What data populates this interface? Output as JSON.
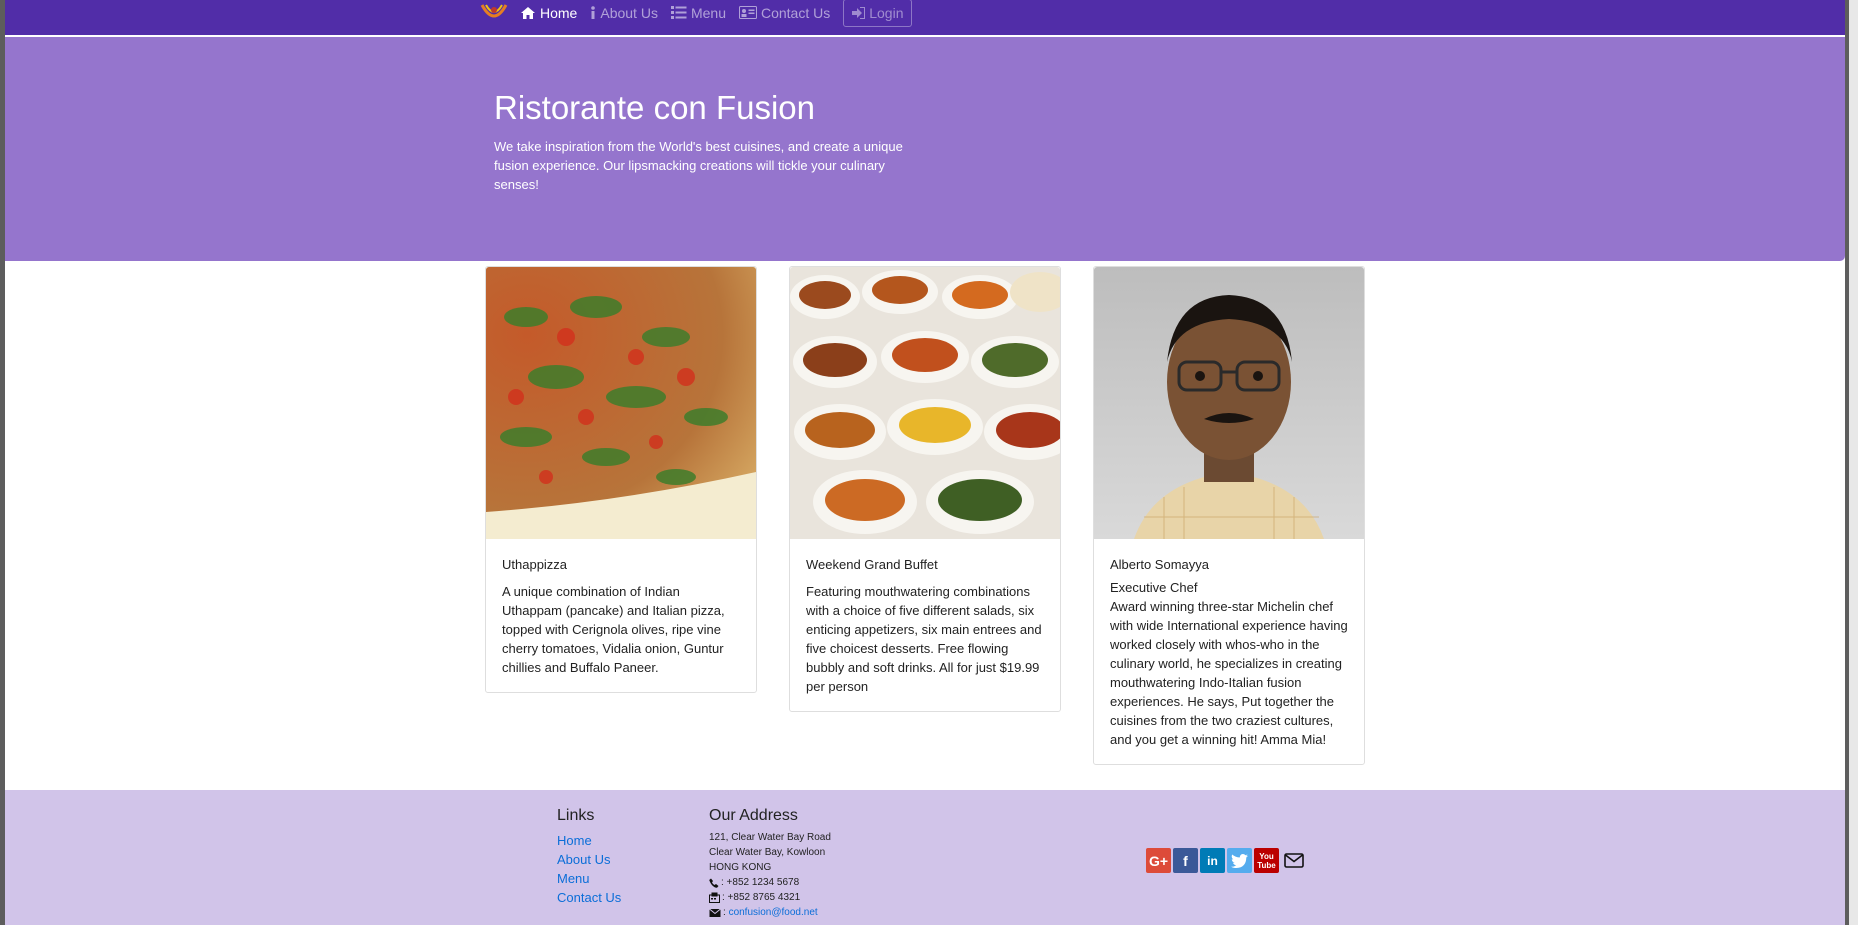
{
  "nav": {
    "items": [
      {
        "label": "Home",
        "active": true
      },
      {
        "label": "About Us"
      },
      {
        "label": "Menu"
      },
      {
        "label": "Contact Us"
      }
    ],
    "login_label": "Login"
  },
  "jumbotron": {
    "title": "Ristorante con Fusion",
    "text": "We take inspiration from the World's best cuisines, and create a unique fusion experience. Our lipsmacking creations will tickle your culinary senses!"
  },
  "cards": [
    {
      "title": "Uthappizza",
      "text": "A unique combination of Indian Uthappam (pancake) and Italian pizza, topped with Cerignola olives, ripe vine cherry tomatoes, Vidalia onion, Guntur chillies and Buffalo Paneer."
    },
    {
      "title": "Weekend Grand Buffet",
      "text": "Featuring mouthwatering combinations with a choice of five different salads, six enticing appetizers, six main entrees and five choicest desserts. Free flowing bubbly and soft drinks. All for just $19.99 per person"
    },
    {
      "title": "Alberto Somayya",
      "subtitle": "Executive Chef",
      "text": "Award winning three-star Michelin chef with wide International experience having worked closely with whos-who in the culinary world, he specializes in creating mouthwatering Indo-Italian fusion experiences. He says, Put together the cuisines from the two craziest cultures, and you get a winning hit! Amma Mia!"
    }
  ],
  "footer": {
    "links_heading": "Links",
    "links": [
      "Home",
      "About Us",
      "Menu",
      "Contact Us"
    ],
    "address_heading": "Our Address",
    "address_lines": [
      "121, Clear Water Bay Road",
      "Clear Water Bay, Kowloon",
      "HONG KONG"
    ],
    "phone": ": +852 1234 5678",
    "fax": ": +852 8765 4321",
    "email": "confusion@food.net",
    "social": [
      "google-plus-icon",
      "facebook-icon",
      "linkedin-icon",
      "twitter-icon",
      "youtube-icon",
      "envelope-icon"
    ]
  },
  "colors": {
    "navbar": "#512da8",
    "jumbotron": "#9575cd",
    "footer": "#d1c4e9",
    "link": "#0b6ed8"
  }
}
